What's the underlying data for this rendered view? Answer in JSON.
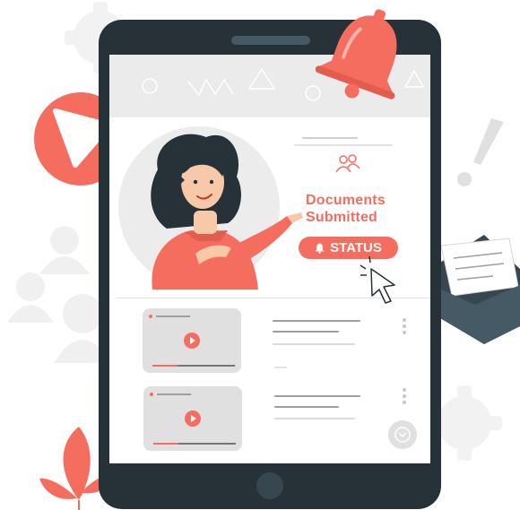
{
  "hero": {
    "title_line1": "Documents",
    "title_line2": "Submitted",
    "status_label": "STATUS"
  },
  "videos": [
    {
      "progress": 0.3
    },
    {
      "progress": 0.3
    }
  ],
  "icons": [
    "bell-icon",
    "play-icon",
    "cursor-icon",
    "envelope-icon",
    "exclamation-icon",
    "user-group-icon",
    "gear-icon",
    "chevron-down-icon",
    "leaf-icon"
  ],
  "colors": {
    "accent": "#f46d5e",
    "tablet": "#263238",
    "screen_header": "#ebebeb",
    "envelope": "#455a64"
  }
}
